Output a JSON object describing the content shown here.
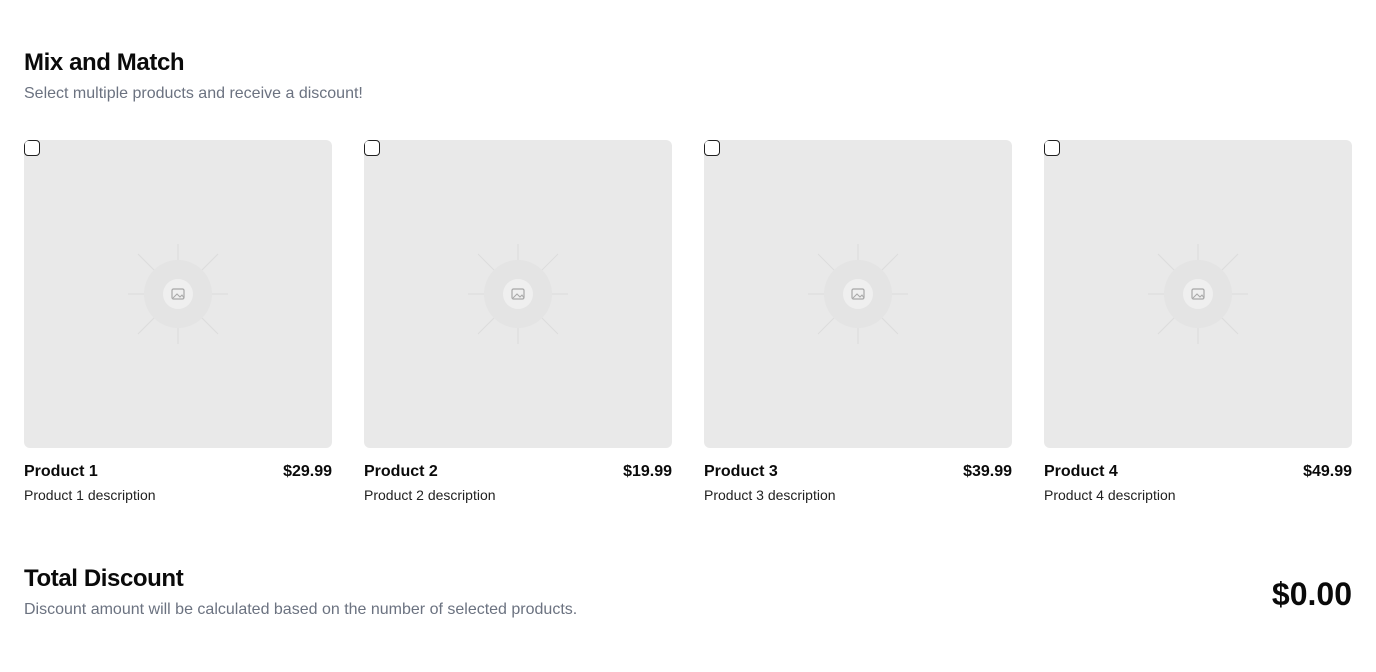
{
  "header": {
    "title": "Mix and Match",
    "subtitle": "Select multiple products and receive a discount!"
  },
  "products": [
    {
      "name": "Product 1",
      "price": "$29.99",
      "description": "Product 1 description",
      "checked": false,
      "image_icon": "image-placeholder-icon"
    },
    {
      "name": "Product 2",
      "price": "$19.99",
      "description": "Product 2 description",
      "checked": false,
      "image_icon": "image-placeholder-icon"
    },
    {
      "name": "Product 3",
      "price": "$39.99",
      "description": "Product 3 description",
      "checked": false,
      "image_icon": "image-placeholder-icon"
    },
    {
      "name": "Product 4",
      "price": "$49.99",
      "description": "Product 4 description",
      "checked": false,
      "image_icon": "image-placeholder-icon"
    }
  ],
  "discount": {
    "title": "Total Discount",
    "subtitle": "Discount amount will be calculated based on the number of selected products.",
    "amount": "$0.00"
  }
}
